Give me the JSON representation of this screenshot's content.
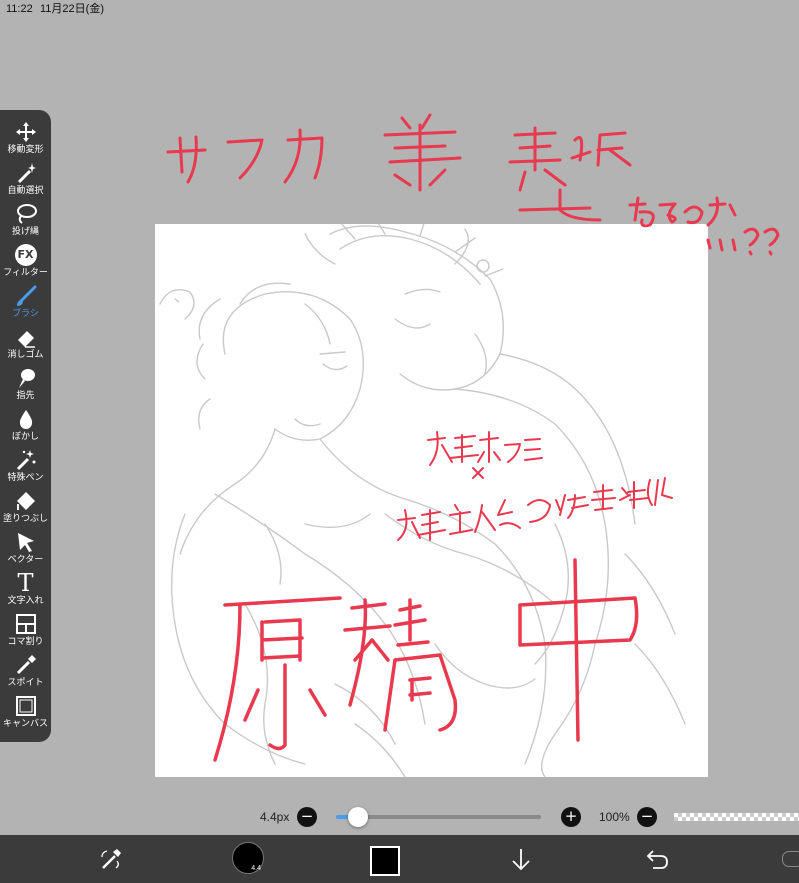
{
  "status_bar": {
    "time": "11:22",
    "date": "11月22日(金)"
  },
  "toolbar": {
    "items": [
      {
        "label": "移動変形",
        "icon": "move-icon"
      },
      {
        "label": "自動選択",
        "icon": "magic-wand-icon"
      },
      {
        "label": "投げ縄",
        "icon": "lasso-icon"
      },
      {
        "label": "フィルター",
        "icon": "fx-icon"
      },
      {
        "label": "ブラシ",
        "icon": "brush-icon",
        "active": true
      },
      {
        "label": "消しゴム",
        "icon": "eraser-icon"
      },
      {
        "label": "指先",
        "icon": "finger-icon"
      },
      {
        "label": "ぼかし",
        "icon": "blur-drop-icon"
      },
      {
        "label": "特殊ペン",
        "icon": "special-pen-icon"
      },
      {
        "label": "塗りつぶし",
        "icon": "fill-bucket-icon"
      },
      {
        "label": "ベクター",
        "icon": "vector-arrow-icon"
      },
      {
        "label": "文字入れ",
        "icon": "text-icon"
      },
      {
        "label": "コマ割り",
        "icon": "frame-divide-icon"
      },
      {
        "label": "スポイト",
        "icon": "eyedropper-icon"
      },
      {
        "label": "キャンバス",
        "icon": "canvas-icon"
      }
    ],
    "fx_glyph": "FX",
    "text_glyph": "T"
  },
  "brush_controls": {
    "size_label": "4.4px",
    "size_fraction": 0.04,
    "opacity_label": "100%",
    "minus": "−",
    "plus": "+"
  },
  "bottom_bar": {
    "brush_size_indicator": "4.4",
    "primary_color": "#000000",
    "accent_color": "#4a9cf0"
  },
  "drawing_colors": {
    "ink_red": "#e8394f",
    "sketch_gray": "#c9c9c9"
  }
}
